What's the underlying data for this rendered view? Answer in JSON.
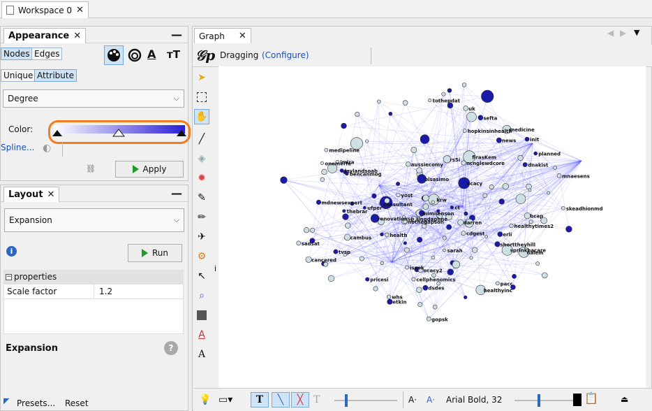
{
  "workspace": {
    "tab_label": "Workspace 0"
  },
  "appearance": {
    "title": "Appearance",
    "tabs": [
      "Nodes",
      "Edges"
    ],
    "subtabs": [
      "Unique",
      "Attribute"
    ],
    "attribute_dropdown": "Degree",
    "color_label": "Color:",
    "spline_label": "Spline...",
    "apply_label": "Apply",
    "gradient_start": "#ffffff",
    "gradient_end": "#2b1fd6",
    "highlight_color": "#f47c20"
  },
  "layout": {
    "title": "Layout",
    "algorithm": "Expansion",
    "run_label": "Run",
    "properties_label": "properties",
    "scale_factor_label": "Scale factor",
    "scale_factor_value": "1.2",
    "description_title": "Expansion",
    "presets_label": "Presets...",
    "reset_label": "Reset"
  },
  "graph": {
    "tab_label": "Graph",
    "mode_label": "Dragging",
    "configure_label": "(Configure)",
    "font_label": "Arial Bold, 32",
    "node_labels": [
      "mdnewsexpert",
      "tvsp",
      "laylandsoab",
      "mimiienson",
      "aussiecomy",
      "isspk",
      "tothepdat",
      "krw",
      "shorttheyhill",
      "erli",
      "imira",
      "thebrar",
      "rs5i",
      "nalem",
      "firasKem",
      "cellphenomics",
      "hopkinsinhealth",
      "medipeline",
      "planned",
      "dsdes",
      "darren",
      "healthyinc",
      "cambus",
      "medicine",
      "sarah",
      "dnakist",
      "ufper",
      "yost",
      "consultant",
      "nothegapson",
      "mnaesens",
      "onemerfe",
      "sefta",
      "uk",
      "bencanmog",
      "pricesi",
      "renovationsp",
      "ncnglewdcore",
      "lingdaphne",
      "cancered",
      "ocacy",
      "ocacy2",
      "ct",
      "news",
      "healthytimes2",
      "pacc",
      "bcap",
      "skeadhionmd",
      "init",
      "health",
      "etkin",
      "bisasimo",
      "gopsk",
      "whs",
      "sprinkhacare",
      "cdgest",
      "sadsat"
    ]
  }
}
